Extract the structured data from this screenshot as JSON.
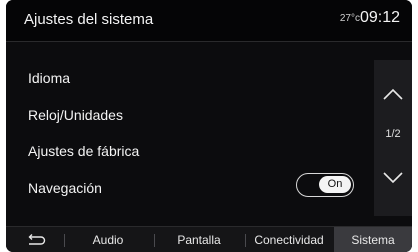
{
  "header": {
    "title": "Ajustes del sistema",
    "temperature": "27°c",
    "time": "09:12"
  },
  "menu": {
    "items": [
      {
        "label": "Idioma"
      },
      {
        "label": "Reloj/Unidades"
      },
      {
        "label": "Ajustes de fábrica"
      },
      {
        "label": "Navegación",
        "toggle": "On"
      }
    ]
  },
  "pager": {
    "indicator": "1/2"
  },
  "tabs": {
    "audio": "Audio",
    "pantalla": "Pantalla",
    "conectividad": "Conectividad",
    "sistema": "Sistema",
    "active": "Sistema"
  },
  "colors": {
    "background": "#0c0c0e",
    "active_tab": "#3a3a3e",
    "text": "#f4f4f4"
  }
}
